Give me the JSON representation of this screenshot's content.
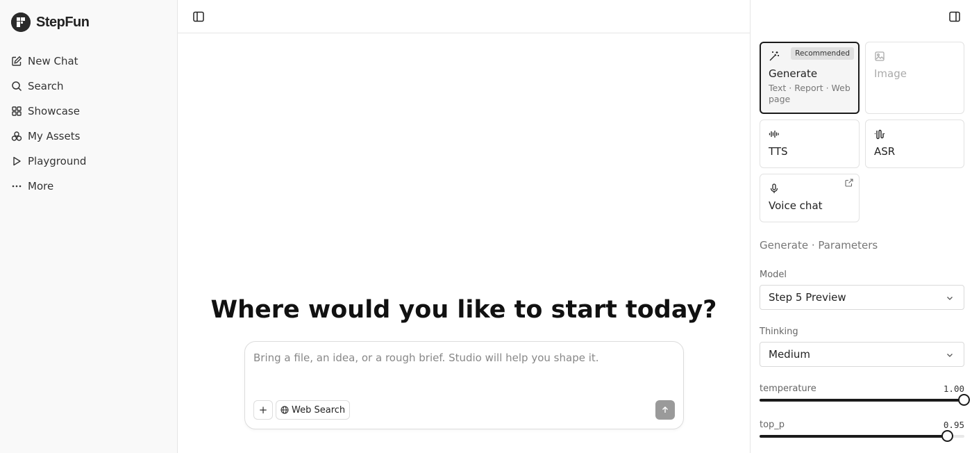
{
  "sidebar": {
    "brand": "StepFun",
    "items": [
      {
        "label": "New Chat",
        "icon": "edit-icon"
      },
      {
        "label": "Search",
        "icon": "search-icon"
      },
      {
        "label": "Showcase",
        "icon": "grid-icon"
      },
      {
        "label": "My Assets",
        "icon": "assets-icon"
      },
      {
        "label": "Playground",
        "icon": "play-icon"
      },
      {
        "label": "More",
        "icon": "more-icon"
      }
    ]
  },
  "main": {
    "headline": "Where would you like to start today?",
    "composer": {
      "placeholder": "Bring a file, an idea, or a rough brief. Studio will help you shape it.",
      "plus_label": "+",
      "web_search_label": "Web Search"
    }
  },
  "panel": {
    "modes": {
      "generate": {
        "label": "Generate",
        "sub": "Text · Report · Web page",
        "badge": "Recommended"
      },
      "image": {
        "label": "Image"
      },
      "tts": {
        "label": "TTS"
      },
      "asr": {
        "label": "ASR"
      },
      "voice_chat": {
        "label": "Voice chat"
      }
    },
    "section_title": "Generate · Parameters",
    "model": {
      "label": "Model",
      "value": "Step 5 Preview"
    },
    "thinking": {
      "label": "Thinking",
      "value": "Medium"
    },
    "temperature": {
      "label": "temperature",
      "value": "1.00",
      "fraction": 1.0
    },
    "top_p": {
      "label": "top_p",
      "value": "0.95",
      "fraction": 0.92
    }
  }
}
